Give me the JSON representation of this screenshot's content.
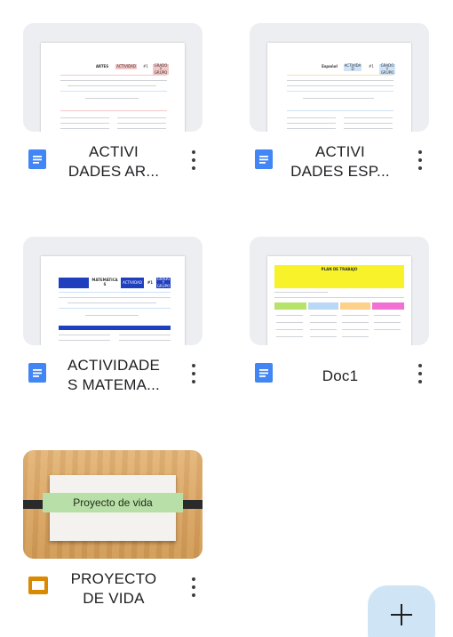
{
  "files": [
    {
      "title_line1": "ACTIVI",
      "title_line2": "DADES AR...",
      "type": "doc",
      "icon": "google-docs-icon",
      "thumb": {
        "h1": "ARTES",
        "h2": "ACTIVIDAD",
        "h3": "#1",
        "h4": "GRADO Y GRUPO",
        "accent": "#f4c7c7"
      }
    },
    {
      "title_line1": "ACTIVI",
      "title_line2": "DADES ESP...",
      "type": "doc",
      "icon": "google-docs-icon",
      "thumb": {
        "h1": "Español",
        "h2": "ACTIVIDA D",
        "h3": "#1",
        "h4": "GRADO Y GRUPO",
        "accent": "#cfe3f7"
      }
    },
    {
      "title_line1": "ACTIVIDADE",
      "title_line2": "S MATEMA...",
      "type": "doc",
      "icon": "google-docs-icon",
      "thumb": {
        "h1": "MATEMÁTICA S",
        "h2": "ACTIVIDAD",
        "h3": "#1",
        "h4": "GRADO Y GRUPO",
        "accent": "#1f3fbf"
      }
    },
    {
      "title": "Doc1",
      "type": "doc",
      "icon": "google-docs-icon",
      "thumb": {
        "h1": "PLAN DE TRABAJO",
        "accent": "#f7f229"
      }
    },
    {
      "title_line1": "PROYECTO",
      "title_line2": "DE VIDA",
      "type": "slides",
      "icon": "google-slides-icon",
      "thumb": {
        "banner": "Proyecto de vida"
      }
    }
  ],
  "fab": {
    "icon": "plus-icon"
  },
  "colors": {
    "docs_blue": "#4285f4",
    "slides_yellow": "#f4b400",
    "fab_bg": "#cfe5f6"
  }
}
